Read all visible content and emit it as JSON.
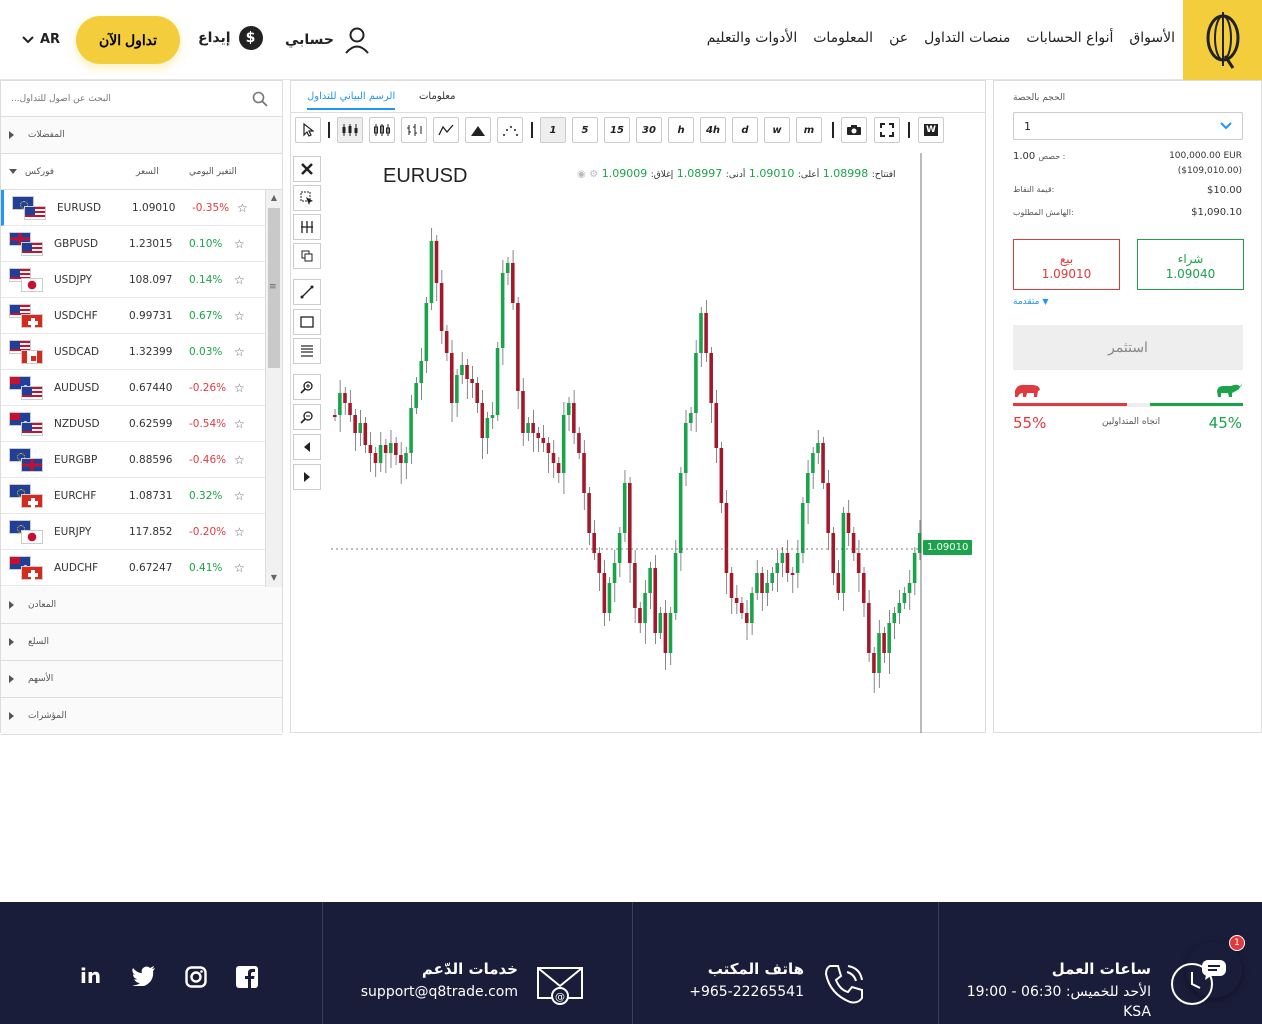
{
  "header": {
    "nav": [
      "الأسواق",
      "أنواع الحسابات",
      "منصات التداول",
      "عن",
      "المعلومات",
      "الأدوات والتعليم"
    ],
    "account_label": "حسابي",
    "deposit_label": "إيداع",
    "trade_now_label": "تداول الآن",
    "lang_label": "AR"
  },
  "left_panel": {
    "search_placeholder": "البحث عن أصول للتداول...",
    "favorites_label": "المفضلات",
    "forex_label": "فوركس",
    "col_price": "السعر",
    "col_change": "التغير اليومي",
    "instruments": [
      {
        "symbol": "EURUSD",
        "price": "1.09010",
        "change": "-0.35%",
        "dir": "dn",
        "f1": "eu",
        "f2": "us"
      },
      {
        "symbol": "GBPUSD",
        "price": "1.23015",
        "change": "0.10%",
        "dir": "up",
        "f1": "gb",
        "f2": "us"
      },
      {
        "symbol": "USDJPY",
        "price": "108.097",
        "change": "0.14%",
        "dir": "up",
        "f1": "us",
        "f2": "jp"
      },
      {
        "symbol": "USDCHF",
        "price": "0.99731",
        "change": "0.67%",
        "dir": "up",
        "f1": "us",
        "f2": "ch"
      },
      {
        "symbol": "USDCAD",
        "price": "1.32399",
        "change": "0.03%",
        "dir": "up",
        "f1": "us",
        "f2": "ca"
      },
      {
        "symbol": "AUDUSD",
        "price": "0.67440",
        "change": "-0.26%",
        "dir": "dn",
        "f1": "au",
        "f2": "us"
      },
      {
        "symbol": "NZDUSD",
        "price": "0.62599",
        "change": "-0.54%",
        "dir": "dn",
        "f1": "nz",
        "f2": "us"
      },
      {
        "symbol": "EURGBP",
        "price": "0.88596",
        "change": "-0.46%",
        "dir": "dn",
        "f1": "eu",
        "f2": "gb"
      },
      {
        "symbol": "EURCHF",
        "price": "1.08731",
        "change": "0.32%",
        "dir": "up",
        "f1": "eu",
        "f2": "ch"
      },
      {
        "symbol": "EURJPY",
        "price": "117.852",
        "change": "-0.20%",
        "dir": "dn",
        "f1": "eu",
        "f2": "jp"
      },
      {
        "symbol": "AUDCHF",
        "price": "0.67247",
        "change": "0.41%",
        "dir": "up",
        "f1": "au",
        "f2": "ch"
      }
    ],
    "categories_bottom": [
      "المعادن",
      "السلع",
      "الأسهم",
      "المؤشرات"
    ]
  },
  "center": {
    "tab_chart": "الرسم البياني للتداول",
    "tab_info": "معلومات",
    "timeframes": [
      "1",
      "5",
      "15",
      "30",
      "h",
      "4h",
      "d",
      "w",
      "m"
    ],
    "symbol": "EURUSD",
    "ohlc": {
      "open_label": "افتتاح:",
      "open": "1.08998",
      "high_label": "أعلى:",
      "high": "1.09010",
      "low_label": "أدنى:",
      "low": "1.08997",
      "close_label": "إغلاق:",
      "close": "1.09009"
    },
    "current_price": "1.09010"
  },
  "right_panel": {
    "volume_label": "الحجم بالحصة",
    "volume_value": "1",
    "shares_label": "حصص :",
    "shares_value": "1.00",
    "notional_eur": "100,000.00 EUR",
    "notional_usd": "($109,010.00)",
    "point_value_label": "قيمة النقاط:",
    "point_value": "$10.00",
    "margin_label": "الهامش المطلوب:",
    "margin_value": "$1,090.10",
    "sell_label": "بيع",
    "sell_price": "1.09010",
    "buy_label": "شراء",
    "buy_price": "1.09040",
    "advanced_label": "متقدمة",
    "invest_label": "استثمر",
    "sentiment_label": "اتجاه المتداولين",
    "sell_pct": "55%",
    "buy_pct": "45%"
  },
  "footer": {
    "hours_title": "ساعات العمل",
    "hours_text": "الأحد للخميس: 06:30 - 19:00",
    "hours_tz": "KSA",
    "phone_title": "هاتف المكتب",
    "phone_text": "+965-22265541",
    "support_title": "خدمات الدّعم",
    "support_text": "support@q8trade.com",
    "chat_badge": "1"
  },
  "colors": {
    "gold": "#f4cd3c",
    "green": "#1aa34a",
    "red": "#e0393e",
    "blue": "#2196f3",
    "footer": "#1a1d3a"
  },
  "chart_data": {
    "type": "candlestick",
    "symbol": "EURUSD",
    "current_price": 1.0901
  }
}
